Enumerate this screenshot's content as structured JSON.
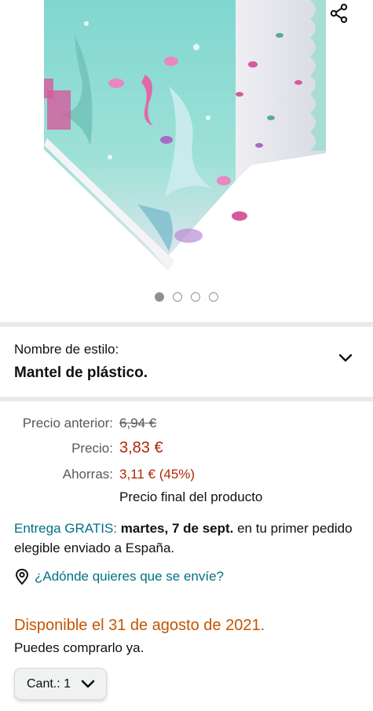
{
  "gallery": {
    "image_alt": "mantel de sirena",
    "dots_count": 4,
    "active_dot": 0
  },
  "style_selector": {
    "label": "Nombre de estilo:",
    "value": "Mantel de plástico."
  },
  "pricing": {
    "old_price_label": "Precio anterior:",
    "old_price": "6,94 €",
    "price_label": "Precio:",
    "price": "3,83 €",
    "savings_label": "Ahorras:",
    "savings": "3,11 € (45%)",
    "final_note": "Precio final del producto"
  },
  "delivery": {
    "free_text": "Entrega GRATIS:",
    "date": "martes, 7 de sept.",
    "rest": " en tu primer pedido elegible enviado a España."
  },
  "location": {
    "text": "¿Adónde quieres que se envíe?"
  },
  "availability": {
    "status": "Disponible el 31 de agosto de 2021.",
    "note": "Puedes comprarlo ya."
  },
  "quantity": {
    "label": "Cant.: 1"
  },
  "colors": {
    "price_red": "#b12704",
    "link_teal": "#007185",
    "availability_orange": "#c45500"
  }
}
